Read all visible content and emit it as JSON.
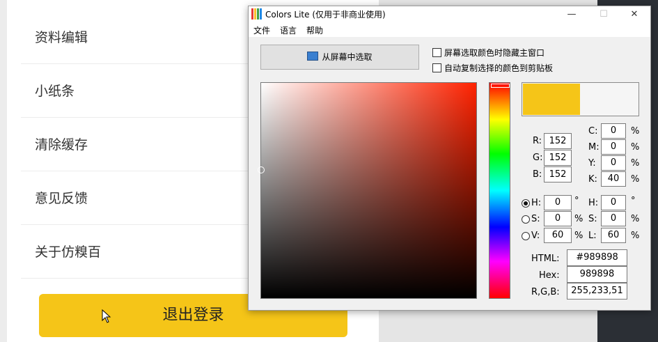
{
  "app": {
    "menu_items": [
      "资料编辑",
      "小纸条",
      "清除缓存",
      "意见反馈",
      "关于仿糗百"
    ],
    "logout_label": "退出登录"
  },
  "window": {
    "title": "Colors Lite (仅用于非商业使用)",
    "controls": {
      "minimize": "—",
      "maximize": "☐",
      "close": "✕"
    },
    "menu": [
      "文件",
      "语言",
      "帮助"
    ],
    "pick_button_label": "从屏幕中选取",
    "options": [
      {
        "label": "屏幕选取颜色时隐藏主窗口",
        "checked": false
      },
      {
        "label": "自动复制选择的颜色到剪贴板",
        "checked": false
      }
    ],
    "swatch": {
      "new_color": "#F5C518",
      "old_color": "#F5F5F5"
    },
    "rgb": {
      "R_label": "R:",
      "R": "152",
      "G_label": "G:",
      "G": "152",
      "B_label": "B:",
      "B": "152"
    },
    "cmyk": {
      "C_label": "C:",
      "C": "0",
      "M_label": "M:",
      "M": "0",
      "Y_label": "Y:",
      "Y": "0",
      "K_label": "K:",
      "K": "40",
      "unit": "%"
    },
    "hsv": {
      "H_label": "H:",
      "H": "0",
      "H_unit": "°",
      "S_label": "S:",
      "S": "0",
      "S_unit": "%",
      "V_label": "V:",
      "V": "60",
      "V_unit": "%",
      "selected": "H"
    },
    "hsl": {
      "H_label": "H:",
      "H": "0",
      "H_unit": "°",
      "S_label": "S:",
      "S": "0",
      "S_unit": "%",
      "L_label": "L:",
      "L": "60",
      "L_unit": "%"
    },
    "codes": {
      "html_label": "HTML:",
      "html": "#989898",
      "hex_label": "Hex:",
      "hex": "989898",
      "rgb_label": "R,G,B:",
      "rgb": "255,233,51"
    }
  }
}
